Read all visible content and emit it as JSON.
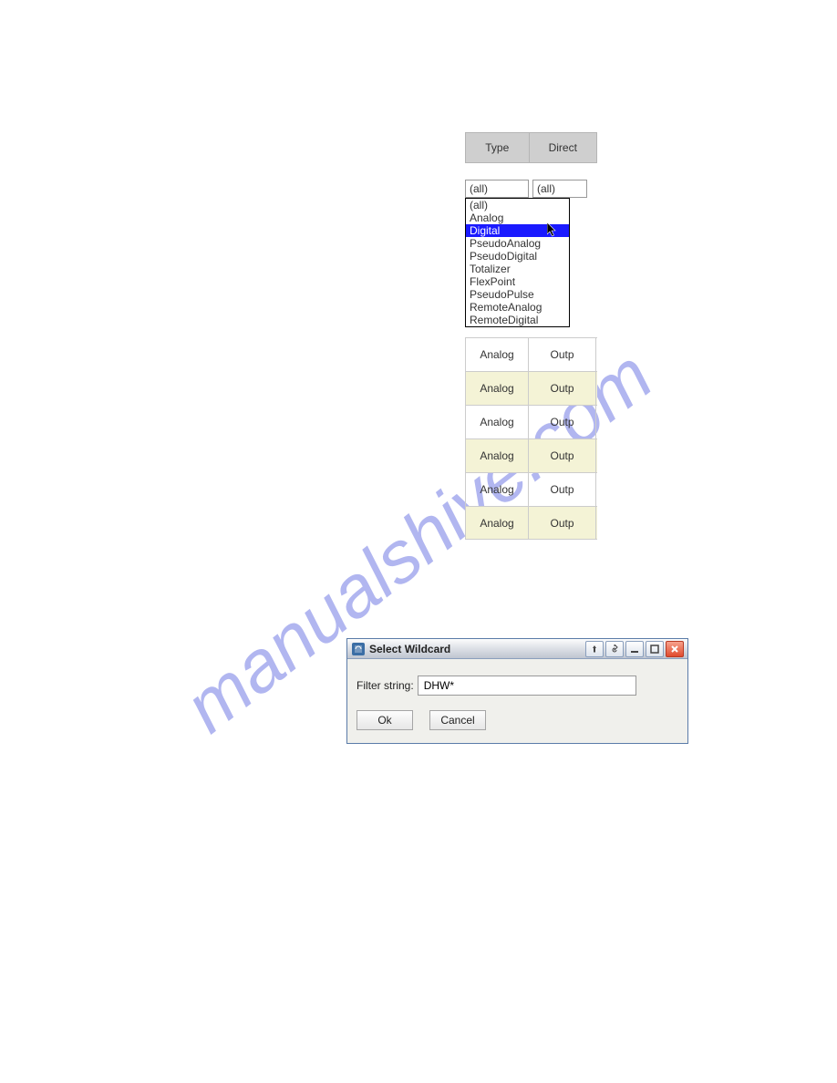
{
  "watermark": "manualshive.com",
  "table": {
    "headers": {
      "type": "Type",
      "direct": "Direct"
    },
    "filters": {
      "type": "(all)",
      "direct": "(all)"
    },
    "dropdown": {
      "items": [
        "(all)",
        "Analog",
        "Digital",
        "PseudoAnalog",
        "PseudoDigital",
        "Totalizer",
        "FlexPoint",
        "PseudoPulse",
        "RemoteAnalog",
        "RemoteDigital"
      ],
      "selected_index": 2
    },
    "rows": [
      {
        "type": "Analog",
        "direct": "Outp"
      },
      {
        "type": "Analog",
        "direct": "Outp"
      },
      {
        "type": "Analog",
        "direct": "Outp"
      },
      {
        "type": "Analog",
        "direct": "Outp"
      },
      {
        "type": "Analog",
        "direct": "Outp"
      },
      {
        "type": "Analog",
        "direct": "Outp"
      }
    ]
  },
  "dialog": {
    "title": "Select Wildcard",
    "filter_label": "Filter string:",
    "filter_value": "DHW*",
    "ok": "Ok",
    "cancel": "Cancel"
  }
}
